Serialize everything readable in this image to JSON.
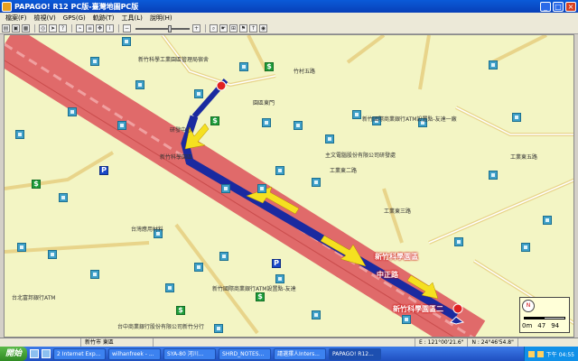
{
  "window": {
    "title": "PAPAGO! R12 PC版-臺灣地圖PC版"
  },
  "menu": [
    "檔案(F)",
    "檢視(V)",
    "GPS(G)",
    "軌跡(T)",
    "工具(L)",
    "說明(H)"
  ],
  "toolbar": {
    "buttons": [
      "open-icon",
      "save-icon",
      "print-icon",
      "gps-icon",
      "route-icon",
      "find-icon",
      "track-icon",
      "pan-icon",
      "zoom-in-icon",
      "zoom-out-icon",
      "info-icon",
      "layer-icon"
    ],
    "zoom_level": 0.65
  },
  "map": {
    "labels": {
      "industrial_admin": "新竹科學工業園區管理局宿舍",
      "rd_center": "研發中心",
      "science_station": "新竹科學園區",
      "north_park": "園區東門",
      "sprite_bank": "新竹國際商業銀行ATM設置點-友達一廠",
      "electronics": "主文電腦股份有限公司研發處",
      "taiwan_chem": "台灣應用材料",
      "west_label": "新竹國際商業銀行ATM設置點-友達",
      "science_label": "新竹科學園區",
      "central_label": "中正路",
      "taiwan_bank": "台北富邦銀行ATM",
      "park_side": "新竹科學園區二",
      "south_bank": "台中商業銀行股份有限公司新竹分行",
      "industrial_e": "工業東三路",
      "industrial_e2": "工業東二路",
      "industrial_e5": "工業東五路",
      "zhuke_5": "竹村五路"
    },
    "scale": {
      "zero": "0m",
      "mid": "47",
      "end": "94"
    }
  },
  "statusbar": {
    "city": "新竹市 東區",
    "coords_e": "E : 121°00'21.6\"",
    "coords_n": "N : 24°46'54.8\""
  },
  "taskbar": {
    "start": "開始",
    "tasks": [
      "2 Internet Exp...",
      "wilhanfreek - ...",
      "SYA-80 河川...",
      "SHRD_NOTES...",
      "請選擇人Inters...",
      "PAPAGO! R12...",
      "Untitled - Paint"
    ],
    "clock": "下午 04:55"
  },
  "colors": {
    "map_bg": "#f3f5c4",
    "highway": "#e06a6a",
    "route": "#1a2aa0",
    "route_arrow": "#f5e020"
  }
}
